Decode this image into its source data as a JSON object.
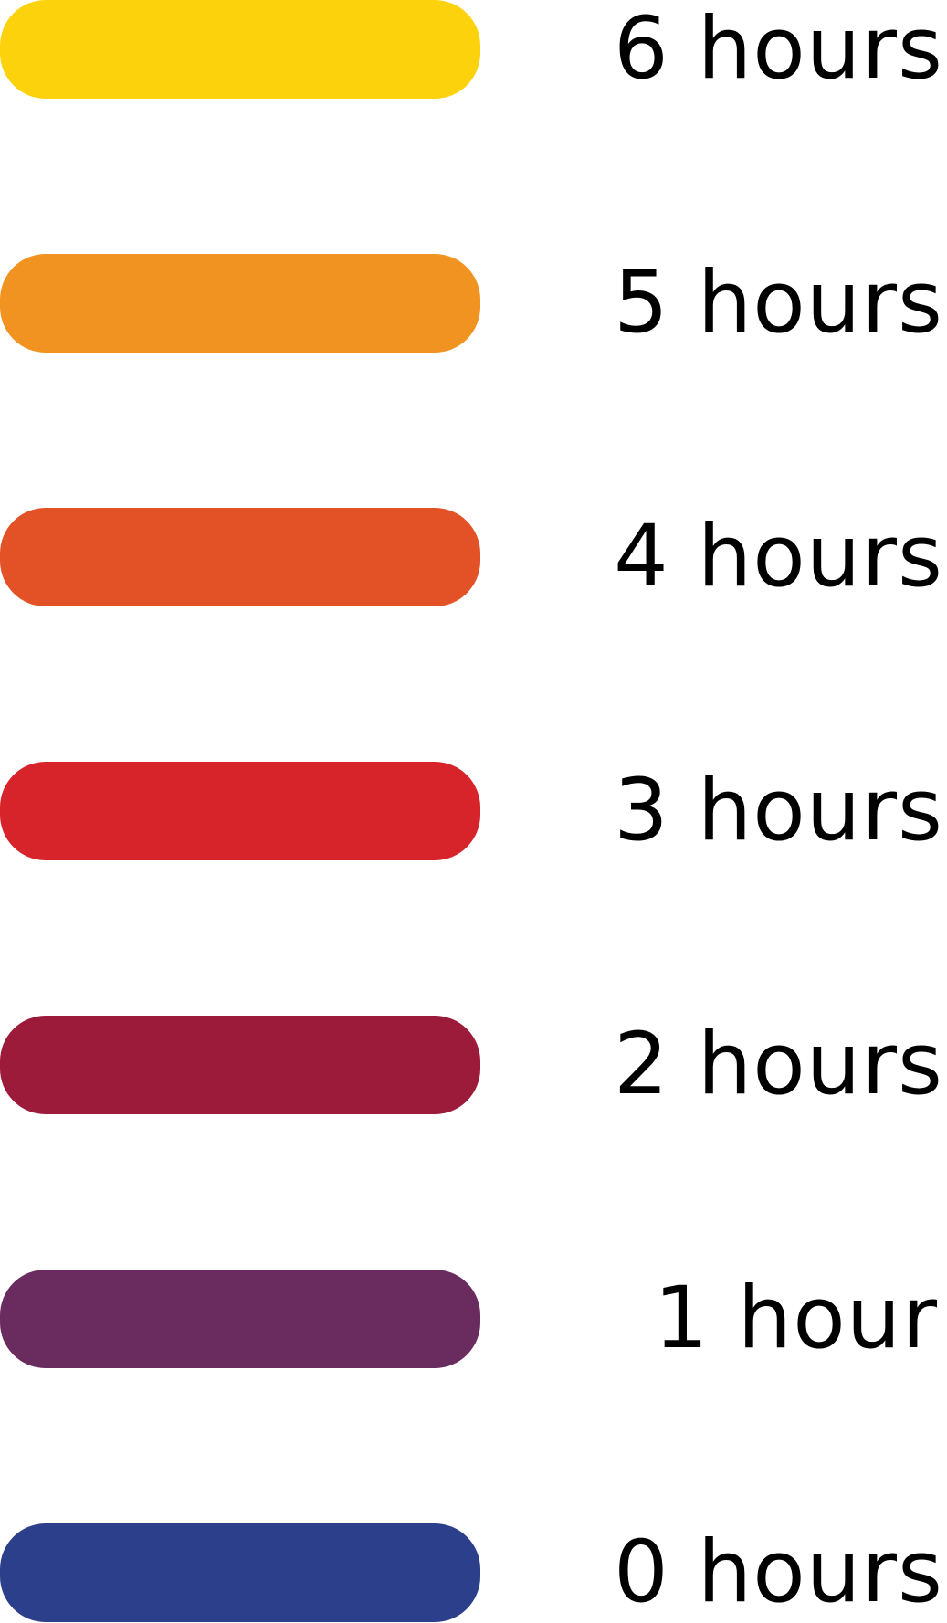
{
  "legend": {
    "items": [
      {
        "label": "6 hours",
        "color": "#FCD20C"
      },
      {
        "label": "5 hours",
        "color": "#F09321"
      },
      {
        "label": "4 hours",
        "color": "#E35226"
      },
      {
        "label": "3 hours",
        "color": "#D7232A"
      },
      {
        "label": "2 hours",
        "color": "#9D1B3A"
      },
      {
        "label": "1 hour",
        "color": "#6A2C5E"
      },
      {
        "label": "0 hours",
        "color": "#2C3F8A"
      }
    ]
  }
}
